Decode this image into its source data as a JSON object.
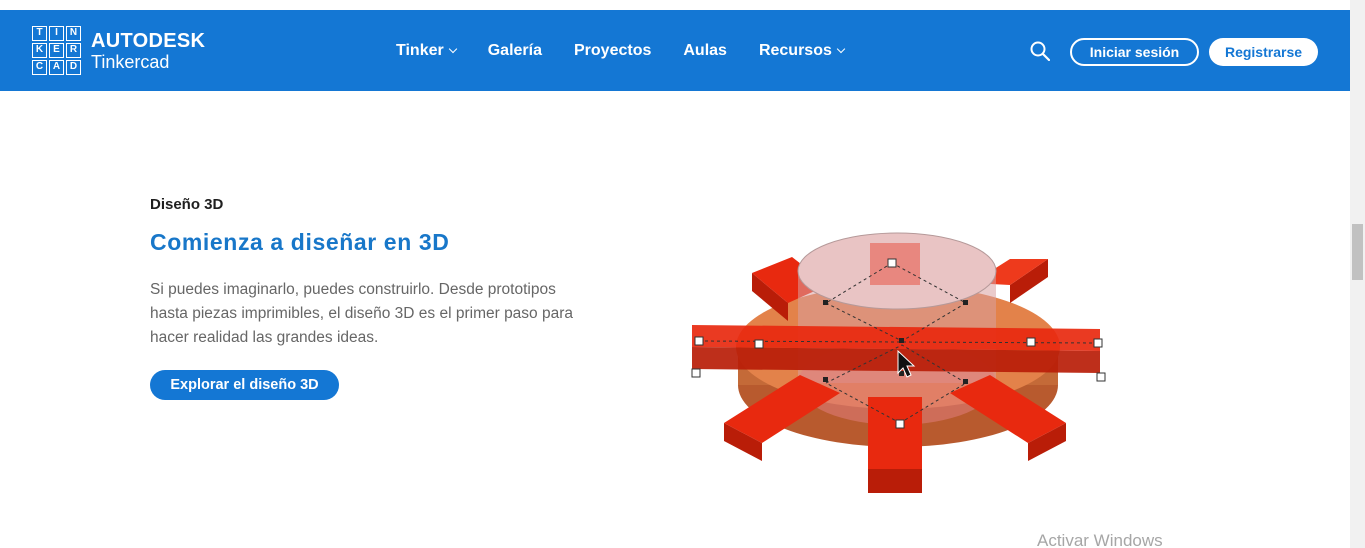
{
  "brand": {
    "logo_letters": [
      "T",
      "I",
      "N",
      "K",
      "E",
      "R",
      "C",
      "A",
      "D"
    ],
    "line1": "AUTODESK",
    "line2": "Tinkercad"
  },
  "nav": {
    "items": [
      {
        "label": "Tinker",
        "dropdown": true
      },
      {
        "label": "Galería",
        "dropdown": false
      },
      {
        "label": "Proyectos",
        "dropdown": false
      },
      {
        "label": "Aulas",
        "dropdown": false
      },
      {
        "label": "Recursos",
        "dropdown": true
      }
    ],
    "search_icon": "search-icon",
    "login_label": "Iniciar sesión",
    "signup_label": "Registrarse"
  },
  "hero": {
    "eyebrow": "Diseño 3D",
    "headline": "Comienza a diseñar en 3D",
    "description": "Si puedes imaginarlo, puedes construirlo. Desde prototipos hasta piezas imprimibles, el diseño 3D es el primer paso para hacer realidad las grandes ideas.",
    "cta_label": "Explorar el diseño 3D",
    "illustration": "3d-gear-design-illustration"
  },
  "watermark": "Activar Windows",
  "colors": {
    "navbar": "#1477d4",
    "headline": "#1877c9",
    "gear_base": "#e3824a",
    "gear_spokes": "#e8290f"
  }
}
